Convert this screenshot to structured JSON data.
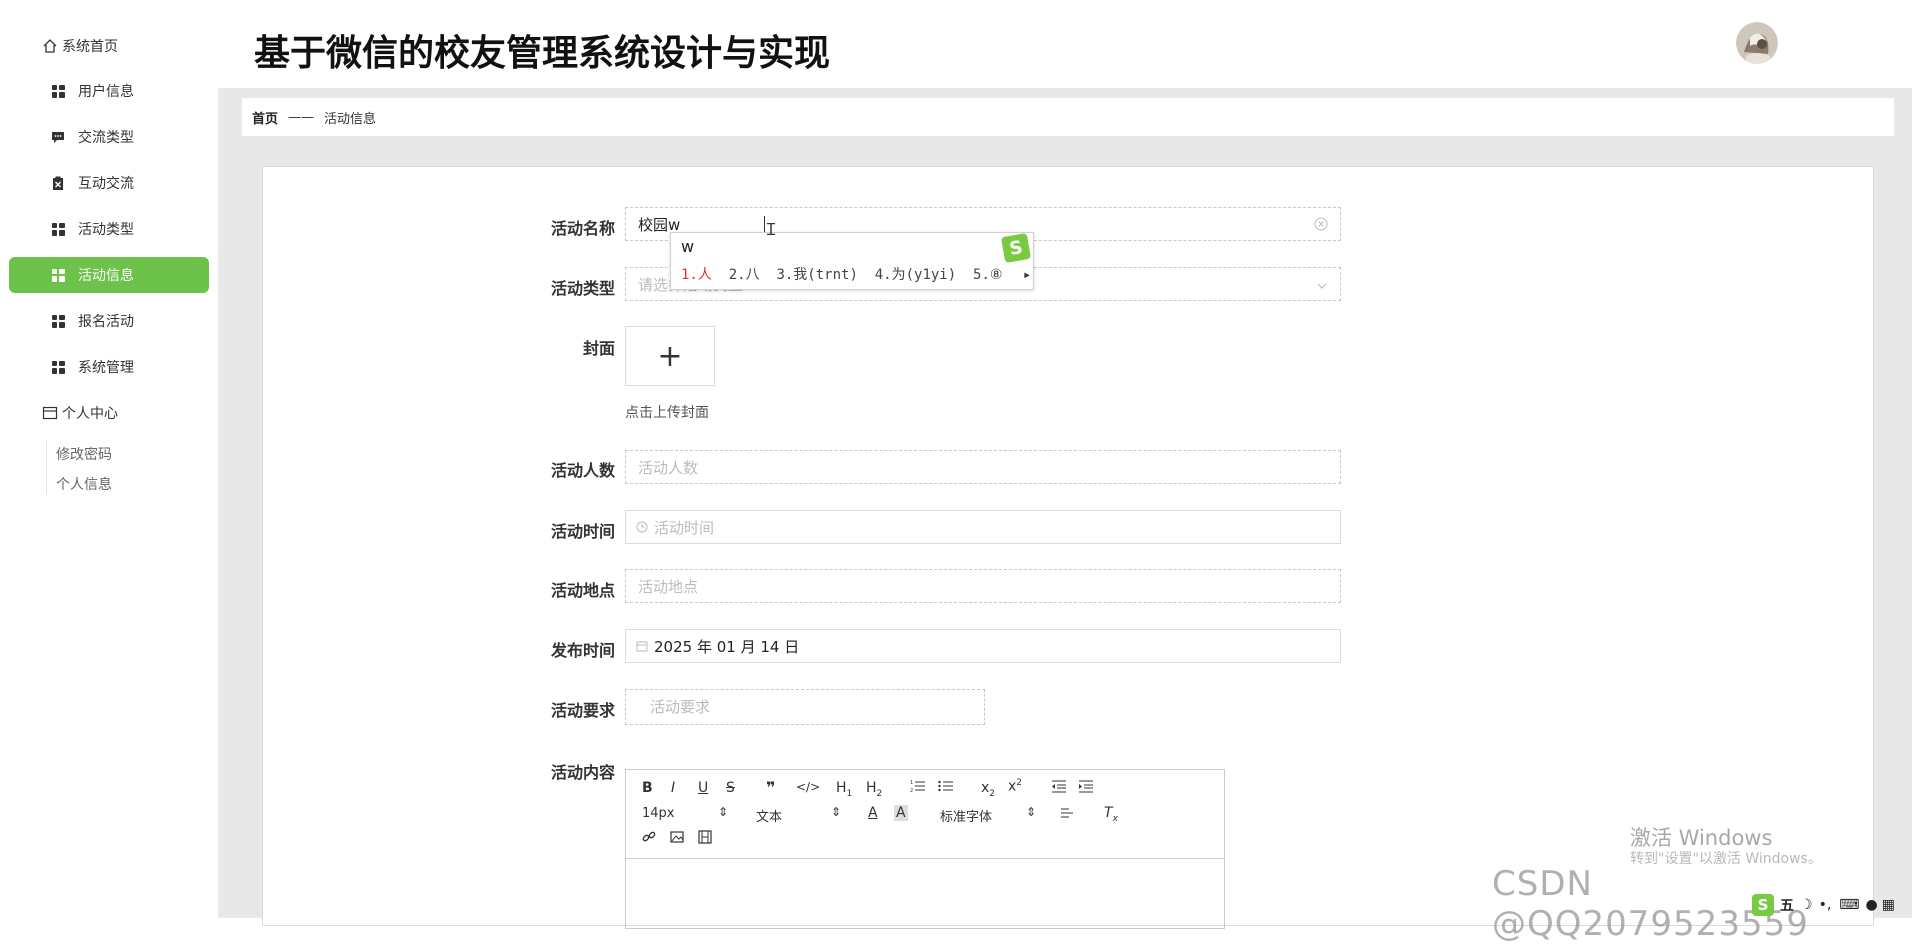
{
  "header": {
    "title": "基于微信的校友管理系统设计与实现"
  },
  "sidebar": {
    "home": "系统首页",
    "items": [
      {
        "label": "用户信息",
        "icon": "grid-icon"
      },
      {
        "label": "交流类型",
        "icon": "chat-icon"
      },
      {
        "label": "互动交流",
        "icon": "clipboard-icon"
      },
      {
        "label": "活动类型",
        "icon": "grid-icon"
      },
      {
        "label": "活动信息",
        "icon": "grid-icon",
        "active": true
      },
      {
        "label": "报名活动",
        "icon": "grid-icon"
      },
      {
        "label": "系统管理",
        "icon": "grid-icon"
      }
    ],
    "personal": "个人中心",
    "sub_items": [
      "修改密码",
      "个人信息"
    ],
    "accent_color": "#6cc24a"
  },
  "breadcrumb": {
    "home": "首页",
    "separator": "——",
    "current": "活动信息"
  },
  "form": {
    "name_label": "活动名称",
    "name_value": "校园w",
    "type_label": "活动类型",
    "type_placeholder": "请选择活动类型",
    "cover_label": "封面",
    "cover_plus": "+",
    "cover_hint": "点击上传封面",
    "count_label": "活动人数",
    "count_placeholder": "活动人数",
    "time_label": "活动时间",
    "time_placeholder": "活动时间",
    "place_label": "活动地点",
    "place_placeholder": "活动地点",
    "publish_label": "发布时间",
    "publish_value": "2025 年 01 月 14 日",
    "req_label": "活动要求",
    "req_placeholder": "活动要求",
    "content_label": "活动内容"
  },
  "editor": {
    "font_size": "14px",
    "paragraph": "文本",
    "font_family": "标准字体"
  },
  "ime": {
    "input": "w",
    "c1": "1.人",
    "c2": "2.八",
    "c3": "3.我(trnt)",
    "c4": "4.为(y1yi)",
    "c5": "5.⑧",
    "logo": "S"
  },
  "watermark": {
    "line1": "激活 Windows",
    "line2": "转到\"设置\"以激活 Windows。"
  },
  "csdn": "CSDN @QQ2079523559",
  "tray": {
    "ime_mode": "五"
  }
}
